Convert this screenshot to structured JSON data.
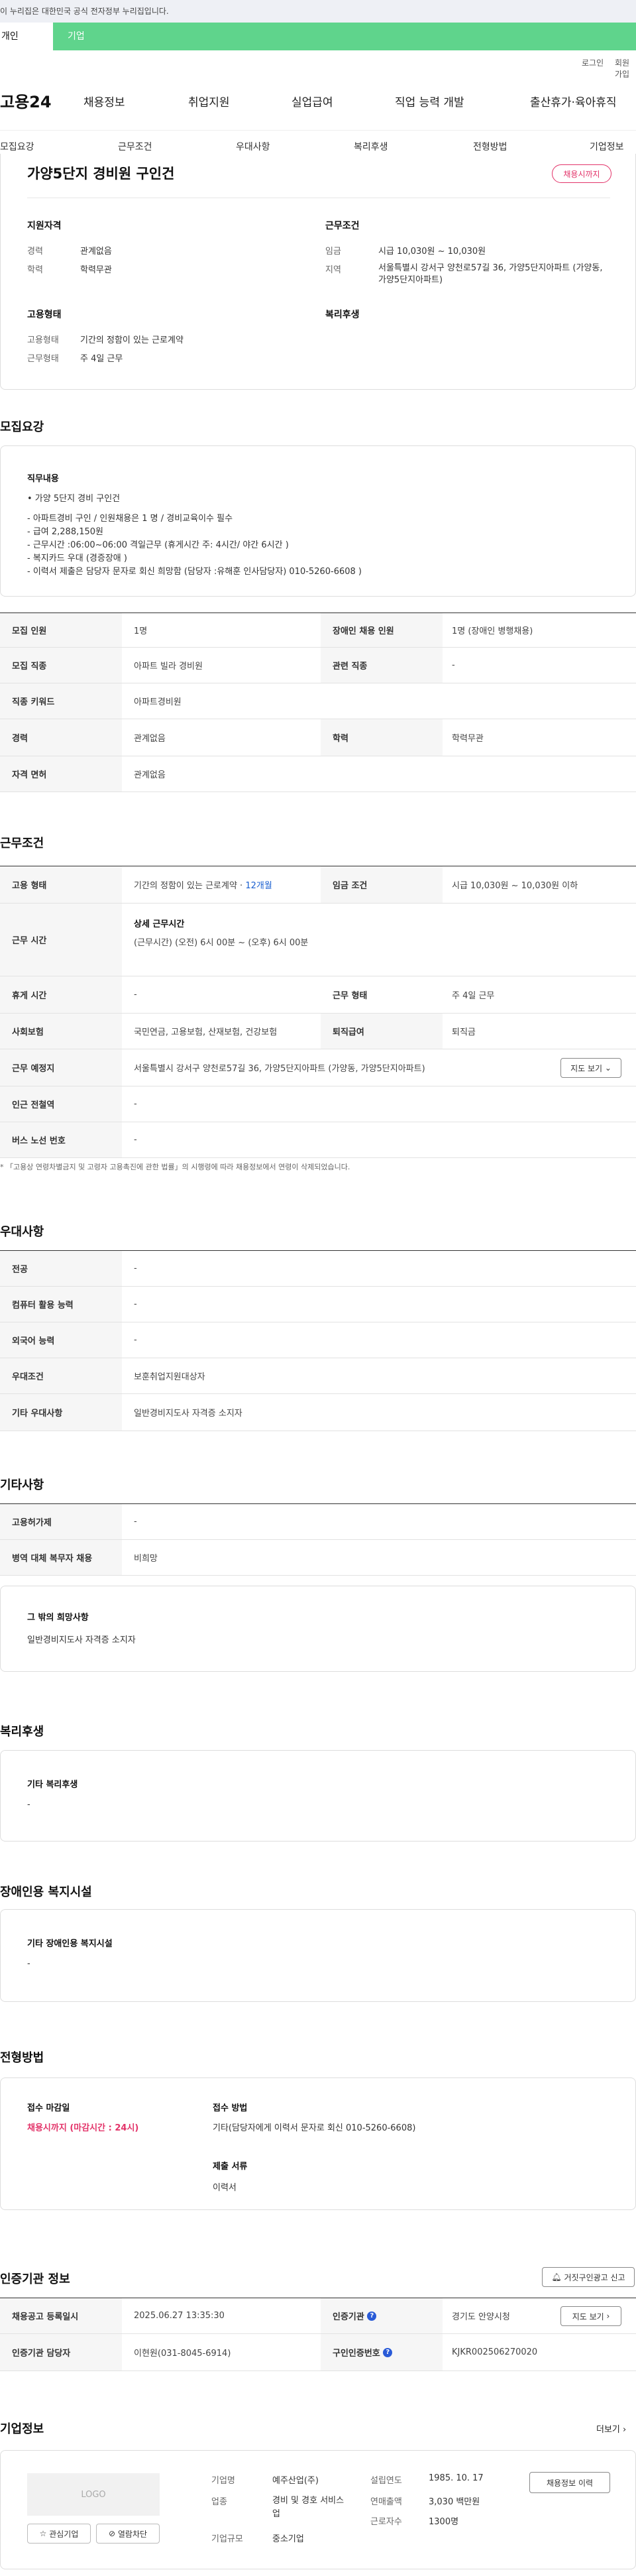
{
  "gov_banner": "이 누리집은 대한민국 공식 전자정부 누리집입니다.",
  "top_tabs": [
    "개인",
    "기업"
  ],
  "util_links": [
    "로그인",
    "회원가입"
  ],
  "logo": "고용24",
  "gnb": [
    "채용정보",
    "취업지원",
    "실업급여",
    "직업 능력 개발",
    "출산휴가·육아휴직"
  ],
  "subnav": [
    "모집요강",
    "근무조건",
    "우대사항",
    "복리후생",
    "전형방법",
    "기업정보"
  ],
  "summary": {
    "title": "가양5단지 경비원 구인건",
    "badge": "채용시까지",
    "req_head": "지원자격",
    "career_l": "경력",
    "career_v": "관계없음",
    "edu_l": "학력",
    "edu_v": "학력무관",
    "cond_head": "근무조건",
    "wage_l": "임금",
    "wage_v": "시급 10,030원 ~ 10,030원",
    "area_l": "지역",
    "area_v": "서울특별시 강서구 양천로57길 36, 가양5단지아파트 (가양동, 가양5단지아파트)",
    "emp_head": "고용형태",
    "emptype_l": "고용형태",
    "emptype_v": "기간의 정함이 있는 근로계약",
    "workform_l": "근무형태",
    "workform_v": "주 4일 근무",
    "welfare_head": "복리후생"
  },
  "recruit": {
    "heading": "모집요강",
    "box_title": "직무내용",
    "box_bullet": "• 가양 5단지 경비 구인건",
    "box_body": "- 아파트경비 구인 / 인원채용은 1 명 / 경비교육이수 필수\n- 급여 2,288,150원\n- 근무시간 :06:00~06:00  격일근무 (휴게시간 주: 4시간/ 야간 6시간 )\n- 복지카드 우대 (경증장애 )\n- 이력서 제출은 담당자 문자로 회신 희망함  (담당자 :유해훈 인사담당자) 010-5260-6608 )",
    "rows": [
      {
        "a": "모집 인원",
        "b": "1명",
        "c": "장애인 채용 인원",
        "d": "1명 (장애인 병행채용)"
      },
      {
        "a": "모집 직종",
        "b": "아파트 빌라 경비원",
        "c": "관련 직종",
        "d": "-"
      },
      {
        "a": "직종 키워드",
        "b": "아파트경비원",
        "c": "",
        "d": ""
      },
      {
        "a": "경력",
        "b": "관계없음",
        "c": "학력",
        "d": "학력무관"
      },
      {
        "a": "자격 면허",
        "b": "관계없음",
        "c": "",
        "d": ""
      }
    ]
  },
  "conditions": {
    "heading": "근무조건",
    "emp_l": "고용 형태",
    "emp_v": "기간의 정함이 있는 근로계약 ·",
    "emp_link": "12개월",
    "wage_l": "임금 조건",
    "wage_v": "시급 10,030원 ~ 10,030원 이하",
    "time_l": "근무 시간",
    "time_sub": "상세 근무시간",
    "time_v": "(근무시간) (오전) 6시 00분 ~ (오후) 6시 00분",
    "rest_l": "휴게 시간",
    "rest_v": "-",
    "form_l": "근무 형태",
    "form_v": "주 4일 근무",
    "ins_l": "사회보험",
    "ins_v": "국민연금, 고용보험, 산재보험, 건강보험",
    "ret_l": "퇴직급여",
    "ret_v": "퇴직금",
    "loc_l": "근무 예정지",
    "loc_v": "서울특별시 강서구 양천로57길 36, 가양5단지아파트 (가양동, 가양5단지아파트)",
    "map_btn": "지도 보기",
    "subway_l": "인근 전철역",
    "subway_v": "-",
    "bus_l": "버스 노선 번호",
    "bus_v": "-",
    "note": "* 「고용상 연령차별금지 및 고령자 고용촉진에 관한 법률」의 시행령에 따라 채용정보에서 연령이 삭제되었습니다."
  },
  "pref": {
    "heading": "우대사항",
    "rows": [
      {
        "l": "전공",
        "v": "-"
      },
      {
        "l": "컴퓨터 활용 능력",
        "v": "-"
      },
      {
        "l": "외국어 능력",
        "v": "-"
      },
      {
        "l": "우대조건",
        "v": "보훈취업지원대상자"
      },
      {
        "l": "기타 우대사항",
        "v": "일반경비지도사 자격증 소지자"
      }
    ]
  },
  "etc": {
    "heading": "기타사항",
    "rows": [
      {
        "l": "고용허가제",
        "v": "-"
      },
      {
        "l": "병역 대체 복무자 채용",
        "v": "비희망"
      }
    ],
    "box_title": "그 밖의 희망사항",
    "box_text": "일반경비지도사 자격증 소지자"
  },
  "welfare": {
    "heading": "복리후생",
    "box_title": "기타 복리후생",
    "box_text": "-"
  },
  "disabled": {
    "heading": "장애인용 복지시설",
    "box_title": "기타 장애인용 복지시설",
    "box_text": "-"
  },
  "process": {
    "heading": "전형방법",
    "deadline_l": "접수 마감일",
    "deadline_v": "채용시까지 (마감시간 : 24시)",
    "method_l": "접수 방법",
    "method_v": "기타(담당자에게 이력서 문자로 회신  010-5260-6608)",
    "docs_l": "제출 서류",
    "docs_v": "이력서"
  },
  "cert": {
    "heading": "인증기관 정보",
    "report_btn": "거짓구인광고 신고",
    "reg_l": "채용공고 등록일시",
    "reg_v": "2025.06.27 13:35:30",
    "org_l": "인증기관",
    "org_v": "경기도 안양시청",
    "org_btn": "지도 보기",
    "mgr_l": "인증기관 담당자",
    "mgr_v": "이현원(031-8045-6914)",
    "num_l": "구인인증번호",
    "num_v": "KJKR002506270020"
  },
  "company": {
    "heading": "기업정보",
    "more": "더보기",
    "logo_text": "LOGO",
    "fav_btn": "관심기업",
    "block_btn": "열람차단",
    "name_l": "기업명",
    "name_v": "예주산업(주)",
    "biz_l": "업종",
    "biz_v": "경비 및 경호 서비스업",
    "size_l": "기업규모",
    "size_v": "중소기업",
    "est_l": "설립연도",
    "est_v": "1985. 10. 17",
    "sales_l": "연매출액",
    "sales_v": "3,030 백만원",
    "emp_l": "근로자수",
    "emp_v": "1300명",
    "history_btn": "채용정보 이력"
  }
}
